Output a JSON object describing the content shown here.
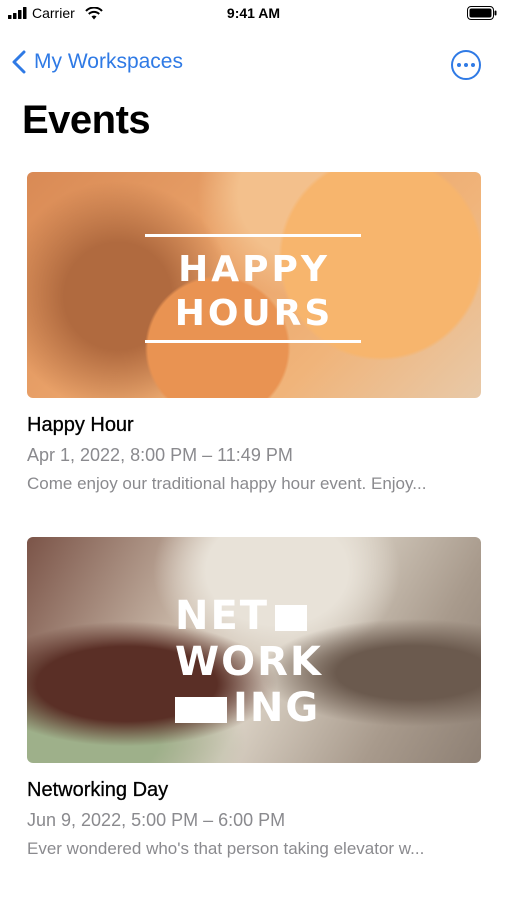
{
  "status_bar": {
    "carrier": "Carrier",
    "time": "9:41 AM"
  },
  "nav": {
    "back_label": "My Workspaces"
  },
  "page": {
    "title": "Events"
  },
  "events": [
    {
      "image_text_line1": "HAPPY",
      "image_text_line2": "HOURS",
      "title": "Happy Hour",
      "date": "Apr 1, 2022, 8:00 PM – 11:49 PM",
      "description": "Come enjoy our traditional happy hour event. Enjoy..."
    },
    {
      "image_text_line1": "NET",
      "image_text_line2": "WORK",
      "image_text_line3": "ING",
      "title": "Networking Day",
      "date": "Jun 9, 2022, 5:00 PM – 6:00 PM",
      "description": "Ever wondered who's that person taking elevator w..."
    }
  ],
  "colors": {
    "accent": "#2f7ae5",
    "secondary_text": "#8a8a8e"
  }
}
